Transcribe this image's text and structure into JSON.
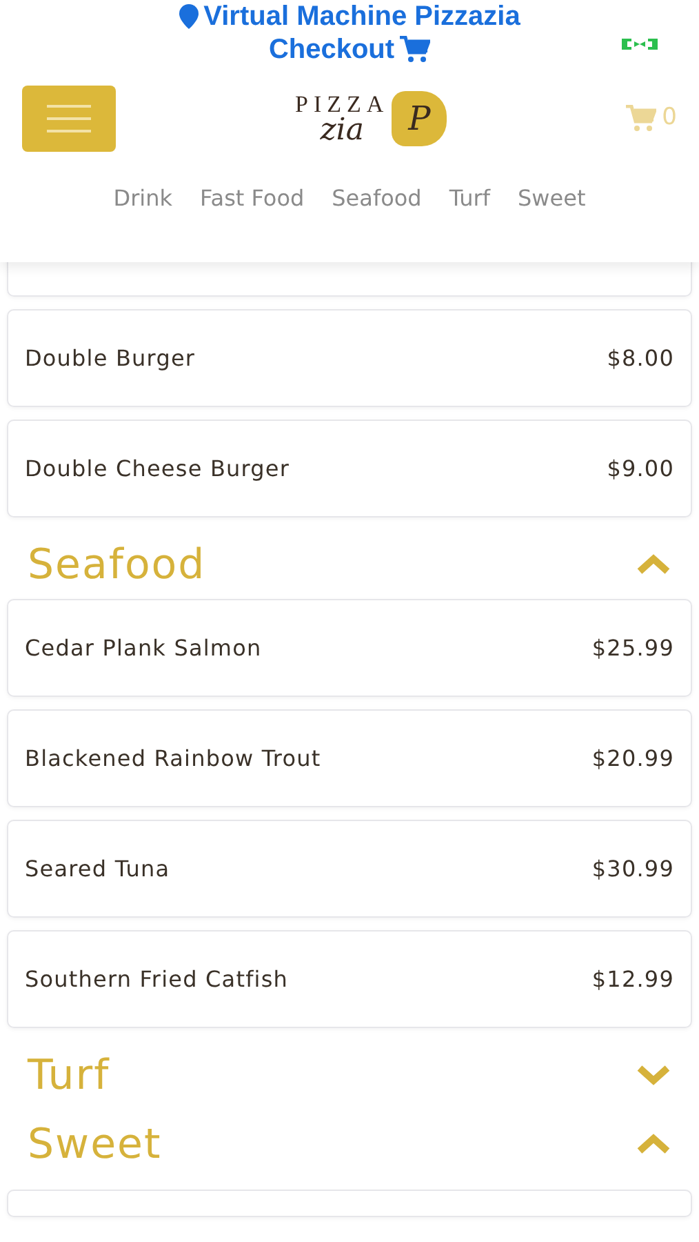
{
  "location": "Virtual Machine Pizzazia",
  "checkout": "Checkout",
  "cart_count": "0",
  "logo": {
    "top": "PIZZA",
    "script": "zia",
    "badge": "P"
  },
  "category_nav": [
    {
      "label": "Drink"
    },
    {
      "label": "Fast Food"
    },
    {
      "label": "Seafood"
    },
    {
      "label": "Turf"
    },
    {
      "label": "Sweet"
    }
  ],
  "sections": [
    {
      "items": [
        {
          "name": "Double Burger",
          "price": "$8.00"
        },
        {
          "name": "Double Cheese Burger",
          "price": "$9.00"
        }
      ]
    },
    {
      "title": "Seafood",
      "expanded": true,
      "items": [
        {
          "name": "Cedar Plank Salmon",
          "price": "$25.99"
        },
        {
          "name": "Blackened Rainbow Trout",
          "price": "$20.99"
        },
        {
          "name": "Seared Tuna",
          "price": "$30.99"
        },
        {
          "name": "Southern Fried Catfish",
          "price": "$12.99"
        }
      ]
    },
    {
      "title": "Turf",
      "expanded": false
    },
    {
      "title": "Sweet",
      "expanded": true
    }
  ]
}
